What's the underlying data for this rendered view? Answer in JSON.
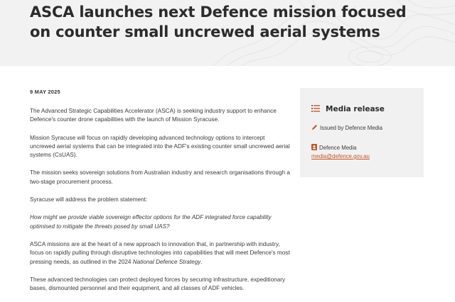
{
  "hero": {
    "title": "ASCA launches next Defence mission focused on counter small uncrewed aerial systems"
  },
  "article": {
    "date": "9 MAY 2025",
    "paragraphs": [
      "The Advanced Strategic Capabilities Accelerator (ASCA) is seeking industry support to enhance Defence's counter drone capabilities with the launch of Mission Syracuse.",
      "Mission Syracuse will focus on rapidly developing advanced technology options to intercept uncrewed aerial systems that can be integrated into the ADF's existing counter small uncrewed aerial systems (CsUAS).",
      "The mission seeks sovereign solutions from Australian industry and research organisations through a two-stage procurement process.",
      "Syracuse will address the problem statement:",
      "How might we provide viable sovereign effector options for the ADF integrated force capability optimised to mitigate the threats posed by small UAS?",
      "ASCA missions are at the heart of a new approach to innovation that, in partnership with industry, focus on rapidly pulling through disruptive technologies into capabilities that will meet Defence's most pressing needs, as outlined in the 2024",
      "National Defence Strategy",
      ".",
      "These advanced technologies can protect deployed forces by securing infrastructure, expeditionary bases, dismounted personnel and their equipment, and all classes of ADF vehicles."
    ]
  },
  "sidebar": {
    "title": "Media release",
    "issued_by": "Issued by Defence Media",
    "contact_name": "Defence Media",
    "contact_email": "media@defence.gov.au"
  },
  "colors": {
    "accent": "#c2562b",
    "hero_bg": "#f2f2f2",
    "sidebar_bg": "#f1f1f1"
  },
  "icons": {
    "media_release": "list-icon",
    "issued_by": "pencil-icon",
    "contact": "contact-card-icon"
  }
}
